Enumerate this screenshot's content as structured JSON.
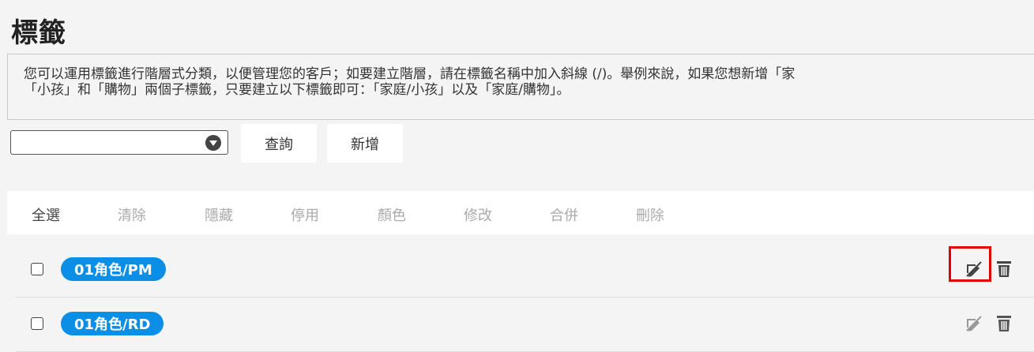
{
  "page": {
    "title": "標籤"
  },
  "info": {
    "line1": "您可以運用標籤進行階層式分類，以便管理您的客戶；如要建立階層，請在標籤名稱中加入斜線 (/)。舉例來說，如果您想新增「家",
    "line2": "「小孩」和「購物」兩個子標籤，只要建立以下標籤即可：「家庭/小孩」以及「家庭/購物」。"
  },
  "filter": {
    "selected_value": ""
  },
  "buttons": {
    "query": "查詢",
    "add": "新增"
  },
  "toolbar": {
    "select_all": "全選",
    "clear": "清除",
    "hide": "隱藏",
    "disable": "停用",
    "color": "顏色",
    "modify": "修改",
    "merge": "合併",
    "delete": "刪除"
  },
  "tags": [
    {
      "name": "01角色/PM",
      "color": "#0a8ee6"
    },
    {
      "name": "01角色/RD",
      "color": "#0a8ee6"
    }
  ],
  "icons": {
    "edit": "edit-pencil-icon",
    "delete": "trash-icon"
  },
  "colors": {
    "highlight": "#e00000",
    "tag": "#0a8ee6"
  }
}
